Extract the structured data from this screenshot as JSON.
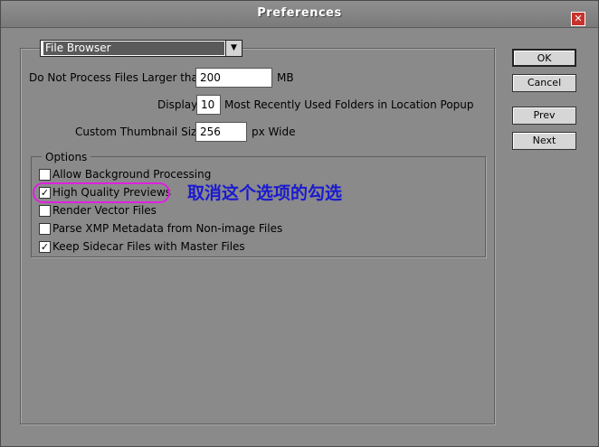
{
  "window": {
    "title": "Preferences"
  },
  "section": {
    "selected": "File Browser"
  },
  "fields": {
    "max_size_label": "Do Not Process Files Larger than:",
    "max_size_value": "200",
    "max_size_unit": "MB",
    "display_label": "Display:",
    "display_value": "10",
    "display_suffix": "Most Recently Used Folders in Location Popup",
    "thumb_label": "Custom Thumbnail Size:",
    "thumb_value": "256",
    "thumb_suffix": "px Wide"
  },
  "options": {
    "legend": "Options",
    "items": [
      {
        "label": "Allow Background Processing",
        "checked": false,
        "mark": ""
      },
      {
        "label": "High Quality Previews",
        "checked": true,
        "mark": "✓"
      },
      {
        "label": "Render Vector Files",
        "checked": false,
        "mark": ""
      },
      {
        "label": "Parse XMP Metadata from Non-image Files",
        "checked": false,
        "mark": ""
      },
      {
        "label": "Keep Sidecar Files with Master Files",
        "checked": true,
        "mark": "✓"
      }
    ]
  },
  "annotation": {
    "text": "取消这个选项的勾选",
    "color": "#1a1ad0",
    "outline_color": "#e020e0"
  },
  "buttons": {
    "ok": "OK",
    "cancel": "Cancel",
    "prev": "Prev",
    "next": "Next"
  }
}
